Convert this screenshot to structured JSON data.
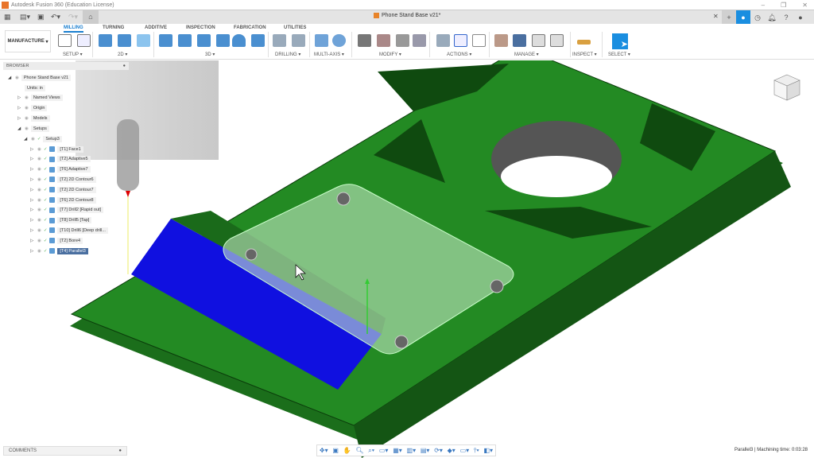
{
  "window": {
    "title": "Autodesk Fusion 360 (Education License)",
    "controls": [
      "–",
      "❐",
      "✕"
    ]
  },
  "document_tab": {
    "title": "Phone Stand Base v21*"
  },
  "workspace": "MANUFACTURE",
  "tabs": [
    "MILLING",
    "TURNING",
    "ADDITIVE",
    "INSPECTION",
    "FABRICATION",
    "UTILITIES"
  ],
  "active_tab": "MILLING",
  "groups": [
    "SETUP ▾",
    "2D ▾",
    "3D ▾",
    "DRILLING ▾",
    "MULTI-AXIS ▾",
    "MODIFY ▾",
    "ACTIONS ▾",
    "MANAGE ▾",
    "INSPECT ▾",
    "SELECT ▾"
  ],
  "browser": {
    "title": "BROWSER",
    "root": "Phone Stand Base v21",
    "items": [
      "Units: in",
      "Named Views",
      "Origin",
      "Models",
      "Setups"
    ],
    "setup": "Setup3",
    "operations": [
      "[T1] Face1",
      "[T2] Adaptive5",
      "[T6] Adaptive7",
      "[T2] 2D Contour6",
      "[T2] 2D Contour7",
      "[T6] 2D Contour8",
      "[T7] Drill2 [Rapid out]",
      "[T8] Drill5 [Tap]",
      "[T10] Drill6 [Deep drill...",
      "[T2] Bore4",
      "[T4] Parallel3"
    ],
    "selected": "[T4] Parallel3"
  },
  "comments": {
    "label": "COMMENTS"
  },
  "status": "Parallel3 | Machining time: 0:03:28",
  "colors": {
    "accent": "#1a8ee0",
    "model": "#1f7a1f",
    "selected_face": "#1010e0"
  }
}
